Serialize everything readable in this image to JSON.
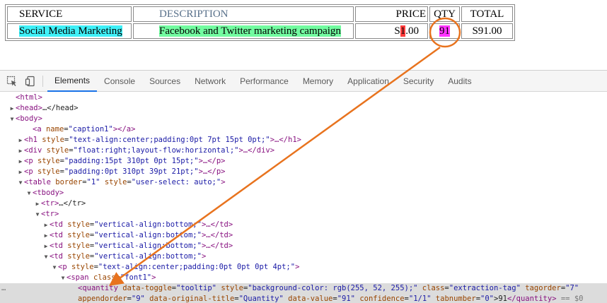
{
  "invoice": {
    "headers": {
      "service": "SERVICE",
      "description": "DESCRIPTION",
      "price": "PRICE",
      "qty": "QTY",
      "total": "TOTAL"
    },
    "row": {
      "service": "Social Media Marketing",
      "description": "Facebook and Twitter marketing campaign",
      "price_prefix": "S",
      "price_highlight": "1",
      "price_suffix": ".00",
      "qty": "91",
      "total": "S91.00"
    },
    "highlight_colors": {
      "service": "#3ff0f7",
      "description": "#72fba0",
      "price": "#ff3b3b",
      "qty": "#ff34ff"
    }
  },
  "devtools": {
    "icons": [
      "inspect-element-icon",
      "device-toolbar-icon"
    ],
    "tabs": [
      "Elements",
      "Console",
      "Sources",
      "Network",
      "Performance",
      "Memory",
      "Application",
      "Security",
      "Audits"
    ],
    "active_tab": "Elements",
    "accent": "#1a73e8",
    "tree": [
      {
        "toggle": "",
        "tag": "<html>"
      },
      {
        "toggle": "▶",
        "tag": "<head>",
        "rest": "…</head>"
      },
      {
        "toggle": "▼",
        "tag": "<body>"
      },
      {
        "toggle": "",
        "open": "<a",
        "an": "name",
        "av": "\"caption1\"",
        "close": "></a>"
      },
      {
        "toggle": "▶",
        "open": "<h1",
        "an": "style",
        "av": "\"text-align:center;padding:0pt 7pt 15pt 0pt;\"",
        "close": ">…</h1>"
      },
      {
        "toggle": "▶",
        "open": "<div",
        "an": "style",
        "av": "\"float:right;layout-flow:horizontal;\"",
        "close": ">…</div>"
      },
      {
        "toggle": "▶",
        "open": "<p",
        "an": "style",
        "av": "\"padding:15pt 310pt 0pt 15pt;\"",
        "close": ">…</p>"
      },
      {
        "toggle": "▶",
        "open": "<p",
        "an": "style",
        "av": "\"padding:0pt 310pt 39pt 21pt;\"",
        "close": ">…</p>"
      },
      {
        "toggle": "▼",
        "open": "<table",
        "an": "border",
        "av": "\"1\"",
        "an2": "style",
        "av2": "\"user-select: auto;\"",
        "close": ">"
      },
      {
        "toggle": "▼",
        "tag": "<tbody>"
      },
      {
        "toggle": "▶",
        "tag": "<tr>",
        "rest": "…</tr>"
      },
      {
        "toggle": "▼",
        "tag": "<tr>"
      },
      {
        "toggle": "▶",
        "open": "<td",
        "an": "style",
        "av": "\"vertical-align:bottom;\"",
        "close": ">…</td>"
      },
      {
        "toggle": "▶",
        "open": "<td",
        "an": "style",
        "av": "\"vertical-align:bottom;\"",
        "close": ">…</td>"
      },
      {
        "toggle": "▶",
        "open": "<td",
        "an": "style",
        "av": "\"vertical-align:bottom;\"",
        "close": ">…</td>"
      },
      {
        "toggle": "▼",
        "open": "<td",
        "an": "style",
        "av": "\"vertical-align:bottom;\"",
        "close": ">"
      },
      {
        "toggle": "▼",
        "open": "<p",
        "an": "style",
        "av": "\"text-align:center;padding:0pt 0pt 0pt 4pt;\"",
        "close": ">"
      },
      {
        "toggle": "▼",
        "open": "<span",
        "an": "class",
        "av": "\"font1\"",
        "close": ">"
      }
    ],
    "selected_node": {
      "line1": [
        {
          "k": "t",
          "v": "<quantity"
        },
        {
          "k": "an",
          "v": " data-toggle"
        },
        {
          "k": "tx",
          "v": "="
        },
        {
          "k": "av",
          "v": "\"tooltip\""
        },
        {
          "k": "an",
          "v": " style"
        },
        {
          "k": "tx",
          "v": "="
        },
        {
          "k": "av",
          "v": "\"background-color: rgb(255, 52, 255);\""
        },
        {
          "k": "an",
          "v": " class"
        },
        {
          "k": "tx",
          "v": "="
        },
        {
          "k": "av",
          "v": "\"extraction-tag\""
        },
        {
          "k": "an",
          "v": " tagorder"
        },
        {
          "k": "tx",
          "v": "="
        },
        {
          "k": "av",
          "v": "\"7\""
        }
      ],
      "line2": [
        {
          "k": "an",
          "v": "appendorder"
        },
        {
          "k": "tx",
          "v": "="
        },
        {
          "k": "av",
          "v": "\"9\""
        },
        {
          "k": "an",
          "v": " data-original-title"
        },
        {
          "k": "tx",
          "v": "="
        },
        {
          "k": "av",
          "v": "\"Quantity\""
        },
        {
          "k": "an",
          "v": " data-value"
        },
        {
          "k": "tx",
          "v": "="
        },
        {
          "k": "av",
          "v": "\"91\""
        },
        {
          "k": "an",
          "v": " confidence"
        },
        {
          "k": "tx",
          "v": "="
        },
        {
          "k": "av",
          "v": "\"1/1\""
        },
        {
          "k": "an",
          "v": " tabnumber"
        },
        {
          "k": "tx",
          "v": "="
        },
        {
          "k": "av",
          "v": "\"0\""
        },
        {
          "k": "tx",
          "v": ">"
        },
        {
          "k": "tx",
          "v": "91"
        },
        {
          "k": "t",
          "v": "</quantity>"
        },
        {
          "k": "eq0",
          "v": " == $0"
        }
      ],
      "gutter": "…"
    }
  },
  "annotation": {
    "color": "#e8731e"
  }
}
